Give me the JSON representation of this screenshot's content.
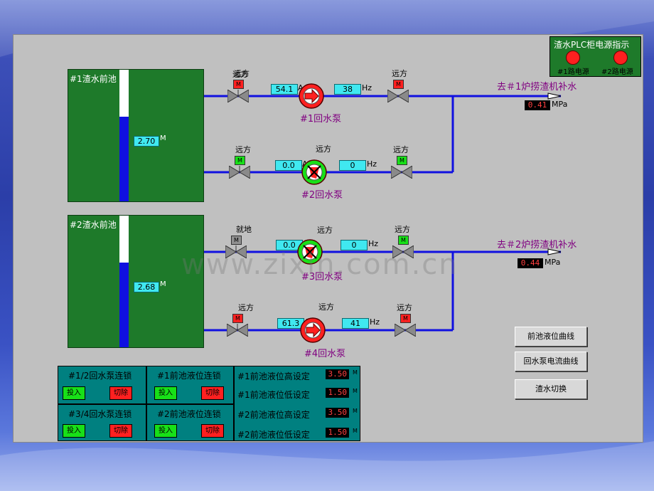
{
  "indicator": {
    "title": "渣水PLC柜电源指示",
    "light1_label": "#1路电源",
    "light2_label": "#2路电源",
    "color": "#ff2020"
  },
  "tanks": [
    {
      "label": "#1渣水前池",
      "level_value": "2.70",
      "level_unit": "M",
      "fill_fraction": 0.6
    },
    {
      "label": "#2渣水前池",
      "level_value": "2.68",
      "level_unit": "M",
      "fill_fraction": 0.6
    }
  ],
  "pumps": [
    {
      "label": "#1回水泵",
      "mode": "远方",
      "current": "54.1",
      "current_unit": "A",
      "freq": "38",
      "freq_unit": "Hz",
      "valve_in_mode": "远方",
      "valve_out_mode": "远方",
      "state": "running"
    },
    {
      "label": "#2回水泵",
      "mode": "远方",
      "current": "0.0",
      "current_unit": "A",
      "freq": "0",
      "freq_unit": "Hz",
      "valve_in_mode": "远方",
      "valve_out_mode": "远方",
      "state": "stopped"
    },
    {
      "label": "#3回水泵",
      "mode": "远方",
      "current": "0.0",
      "current_unit": "A",
      "freq": "0",
      "freq_unit": "Hz",
      "valve_in_mode": "就地",
      "valve_out_mode": "远方",
      "state": "stopped"
    },
    {
      "label": "#4回水泵",
      "mode": "远方",
      "current": "61.3",
      "current_unit": "A",
      "freq": "41",
      "freq_unit": "Hz",
      "valve_in_mode": "远方",
      "valve_out_mode": "远方",
      "state": "running"
    }
  ],
  "valve_m_label": "M",
  "outlets": [
    {
      "label": "去＃1炉捞渣机补水",
      "pressure": "0.41",
      "unit": "MPa"
    },
    {
      "label": "去＃2炉捞渣机补水",
      "pressure": "0.44",
      "unit": "MPa"
    }
  ],
  "interlocks": [
    {
      "title": "#1/2回水泵连锁",
      "on": "投入",
      "off": "切除"
    },
    {
      "title": "#1前池液位连锁",
      "on": "投入",
      "off": "切除"
    },
    {
      "title": "#3/4回水泵连锁",
      "on": "投入",
      "off": "切除"
    },
    {
      "title": "#2前池液位连锁",
      "on": "投入",
      "off": "切除"
    }
  ],
  "settings": [
    {
      "label": "#1前池液位高设定",
      "value": "3.50",
      "unit": "M"
    },
    {
      "label": "#1前池液位低设定",
      "value": "1.50",
      "unit": "M"
    },
    {
      "label": "#2前池液位高设定",
      "value": "3.50",
      "unit": "M"
    },
    {
      "label": "#2前池液位低设定",
      "value": "1.50",
      "unit": "M"
    }
  ],
  "buttons": {
    "level_curve": "前池液位曲线",
    "current_curve": "回水泵电流曲线",
    "switch": "渣水切换"
  },
  "watermark": "www.zixin.com.cn"
}
